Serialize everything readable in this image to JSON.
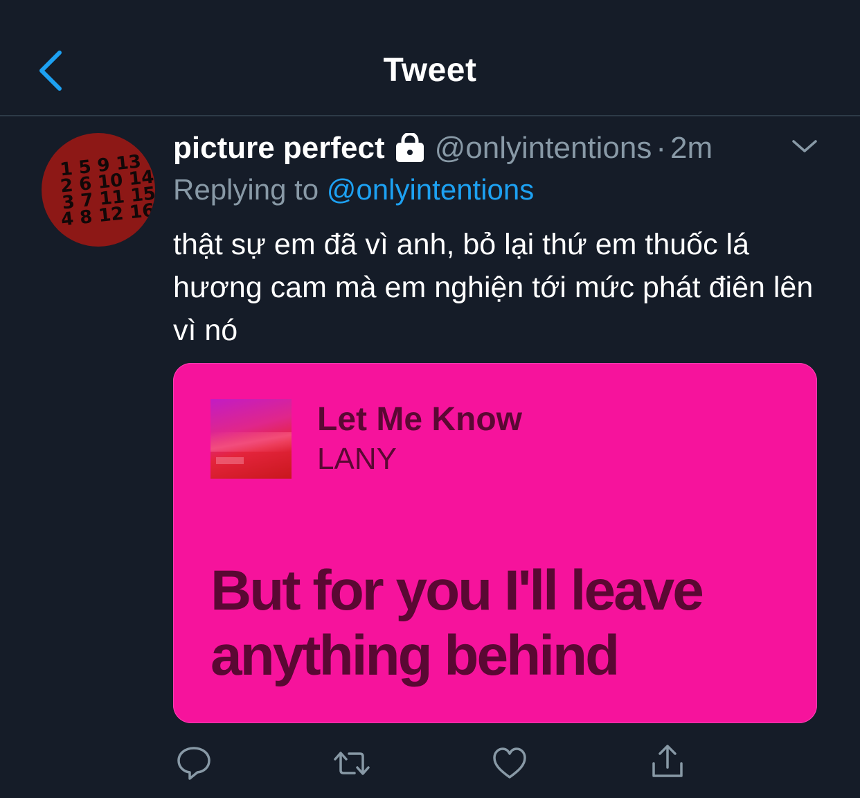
{
  "header": {
    "title": "Tweet"
  },
  "tweet": {
    "display_name": "picture perfect",
    "handle": "@onlyintentions",
    "separator": "·",
    "time": "2m",
    "reply_label": "Replying to",
    "reply_to": "@onlyintentions",
    "text": "thật sự em đã vì anh, bỏ lại thứ em thuốc lá hương cam mà em nghiện tới mức phát điên lên vì nó",
    "avatar_numbers": [
      "1 5 9 13",
      "2 6 10 14",
      "3 7 11 15",
      "4 8 12 16"
    ]
  },
  "card": {
    "song_title": "Let Me Know",
    "artist": "LANY",
    "lyric": "But for you I'll leave anything behind",
    "background": "#f6139c",
    "text_color": "#5a0833"
  },
  "actions": {
    "icons": [
      "reply-icon",
      "retweet-icon",
      "like-icon",
      "share-icon"
    ]
  },
  "colors": {
    "background": "#151c28",
    "accent": "#1da1f2",
    "muted": "#8899a6"
  }
}
